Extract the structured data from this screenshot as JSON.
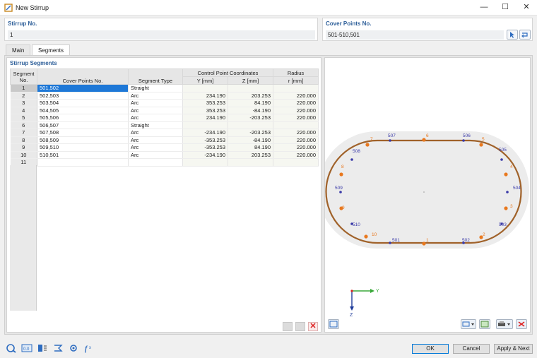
{
  "window": {
    "title": "New Stirrup",
    "minimize": "—",
    "maximize": "☐",
    "close": "✕"
  },
  "stirrup_no": {
    "label": "Stirrup No.",
    "value": "1"
  },
  "cover_points": {
    "label": "Cover Points No.",
    "value": "501-510,501"
  },
  "tabs": [
    {
      "label": "Main"
    },
    {
      "label": "Segments"
    }
  ],
  "active_tab": "Segments",
  "segments": {
    "title": "Stirrup Segments",
    "headers": {
      "segment": "Segment",
      "no": "No.",
      "cover_points": "Cover Points No.",
      "segment_type": "Segment Type",
      "control_point": "Control Point Coordinates",
      "y": "Y [mm]",
      "z": "Z [mm]",
      "radius": "Radius",
      "r": "r [mm]"
    },
    "rows": [
      {
        "no": "1",
        "points": "501,502",
        "type": "Straight",
        "y": "",
        "z": "",
        "r": ""
      },
      {
        "no": "2",
        "points": "502,503",
        "type": "Arc",
        "y": "234.190",
        "z": "203.253",
        "r": "220.000"
      },
      {
        "no": "3",
        "points": "503,504",
        "type": "Arc",
        "y": "353.253",
        "z": "84.190",
        "r": "220.000"
      },
      {
        "no": "4",
        "points": "504,505",
        "type": "Arc",
        "y": "353.253",
        "z": "-84.190",
        "r": "220.000"
      },
      {
        "no": "5",
        "points": "505,506",
        "type": "Arc",
        "y": "234.190",
        "z": "-203.253",
        "r": "220.000"
      },
      {
        "no": "6",
        "points": "506,507",
        "type": "Straight",
        "y": "",
        "z": "",
        "r": ""
      },
      {
        "no": "7",
        "points": "507,508",
        "type": "Arc",
        "y": "-234.190",
        "z": "-203.253",
        "r": "220.000"
      },
      {
        "no": "8",
        "points": "508,509",
        "type": "Arc",
        "y": "-353.253",
        "z": "-84.190",
        "r": "220.000"
      },
      {
        "no": "9",
        "points": "509,510",
        "type": "Arc",
        "y": "-353.253",
        "z": "84.190",
        "r": "220.000"
      },
      {
        "no": "10",
        "points": "510,501",
        "type": "Arc",
        "y": "-234.190",
        "z": "203.253",
        "r": "220.000"
      },
      {
        "no": "11",
        "points": "",
        "type": "",
        "y": "",
        "z": "",
        "r": ""
      }
    ]
  },
  "diagram": {
    "cover_points": [
      "501",
      "502",
      "503",
      "504",
      "505",
      "506",
      "507",
      "508",
      "509",
      "510"
    ],
    "segment_labels": [
      "1",
      "2",
      "3",
      "4",
      "5",
      "6",
      "7",
      "8",
      "9",
      "10"
    ],
    "axis_y": "Y",
    "axis_z": "Z",
    "stirrup_color": "#a0622a",
    "cover_point_color": "#3a3aa8",
    "segment_label_color": "#e8781e"
  },
  "footer": {
    "ok": "OK",
    "cancel": "Cancel",
    "apply_next": "Apply & Next"
  },
  "icons": [
    "help-icon",
    "units-icon",
    "display-icon",
    "model-icon",
    "settings-icon",
    "formula-icon"
  ]
}
